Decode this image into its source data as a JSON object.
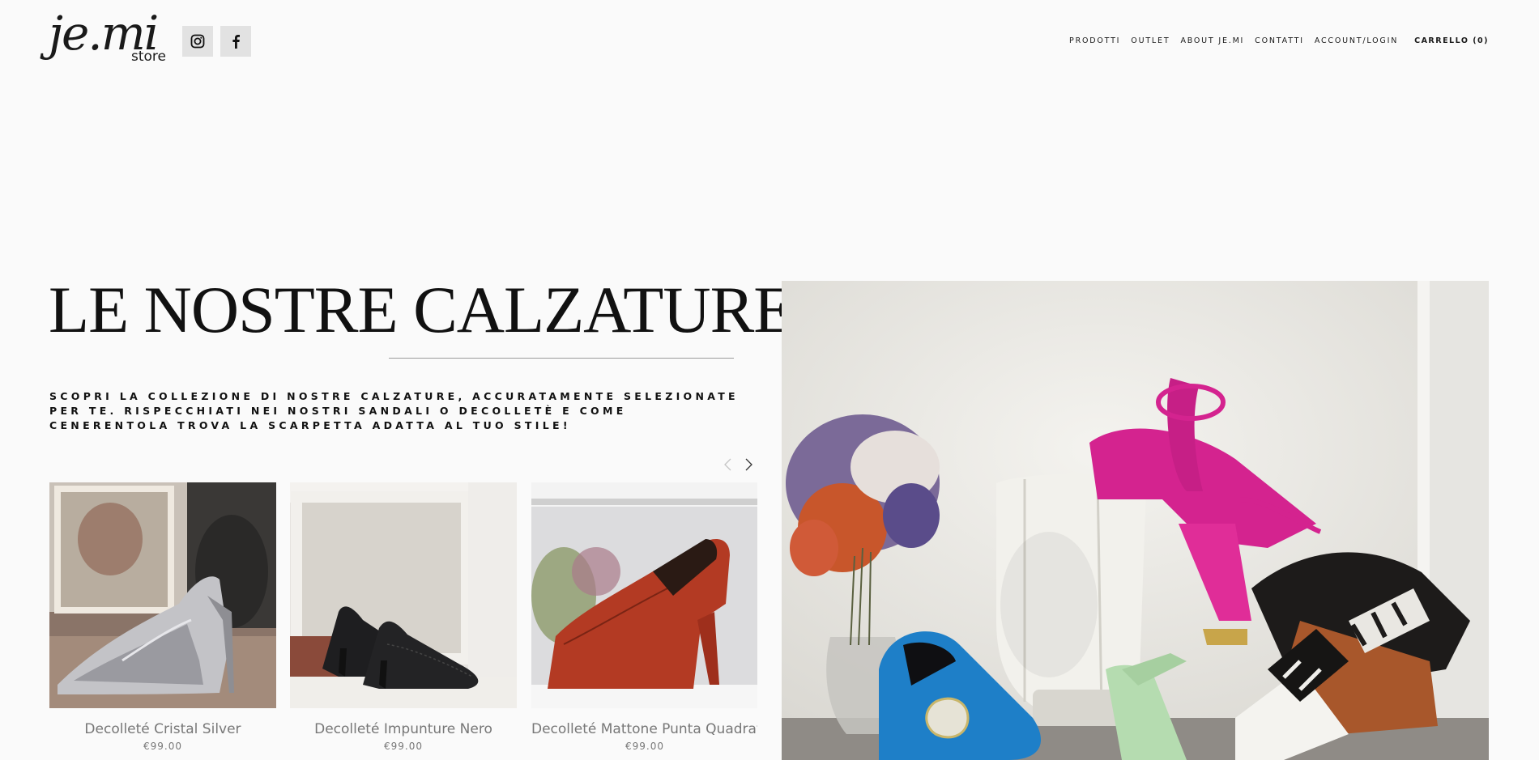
{
  "header": {
    "logo_main": "je.mi",
    "logo_sub": "store",
    "social": [
      {
        "icon": "instagram-icon"
      },
      {
        "icon": "facebook-icon"
      }
    ]
  },
  "nav": {
    "items": [
      "PRODOTTI",
      "OUTLET",
      "ABOUT JE.MI",
      "CONTATTI",
      "ACCOUNT/LOGIN"
    ],
    "cart": "CARRELLO (0)"
  },
  "main": {
    "title": "LE NOSTRE CALZATURE",
    "description": "SCOPRI LA COLLEZIONE DI NOSTRE CALZATURE, ACCURATAMENTE SELEZIONATE PER TE. RISPECCHIATI NEI NOSTRI SANDALI O DECOLLETÈ E COME CENERENTOLA TROVA LA SCARPETTA ADATTA AL TUO STILE!"
  },
  "products": [
    {
      "name": "Decolleté Cristal Silver",
      "price": "€99.00",
      "color": "#b8b8bc"
    },
    {
      "name": "Decolleté Impunture Nero",
      "price": "€99.00",
      "color": "#1c1c1e"
    },
    {
      "name": "Decolleté Mattone Punta Quadrata",
      "price": "€99.00",
      "color": "#b23a24"
    }
  ],
  "colors": {
    "background": "#fafafa",
    "text": "#111111",
    "muted": "#777777",
    "social_bg": "#e2e2e2",
    "hero_pink": "#d4238f",
    "hero_blue": "#1e7fc8",
    "hero_mint": "#b5dcb0"
  }
}
